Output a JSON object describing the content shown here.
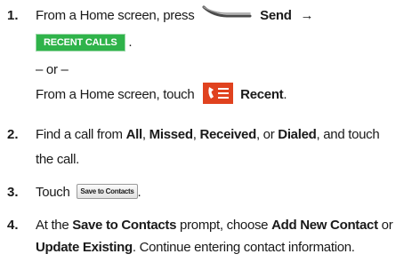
{
  "steps": [
    {
      "number": "1.",
      "line1_prefix": "From a Home screen, press",
      "line1_key": "Send",
      "line1_arrow": "→",
      "tab_label": "RECENT CALLS",
      "tab_suffix": ".",
      "or_text": "– or –",
      "alt_prefix": "From a Home screen, touch",
      "alt_bold": "Recent",
      "alt_suffix": "."
    },
    {
      "number": "2.",
      "line1_prefix": "Find a call from ",
      "all": "All",
      "sep1": ", ",
      "missed": "Missed",
      "sep2": ", ",
      "received": "Received",
      "sep3": ", or ",
      "dialed": "Dialed",
      "line1_suffix": ", and touch",
      "line2": "the call."
    },
    {
      "number": "3.",
      "prefix": "Touch",
      "button_label": "Save to Contacts",
      "suffix": "."
    },
    {
      "number": "4.",
      "prefix": "At the ",
      "prompt": "Save to Contacts",
      "mid": " prompt, choose ",
      "add_new": "Add New Contact",
      "or": " or",
      "update": "Update Existing",
      "suffix": ". Continue entering contact information."
    }
  ],
  "icons": {
    "send_key": "send-key-icon",
    "recent": "recent-calls-icon"
  },
  "colors": {
    "tab_green": "#2fb34a",
    "recent_icon_red": "#e0421f"
  }
}
